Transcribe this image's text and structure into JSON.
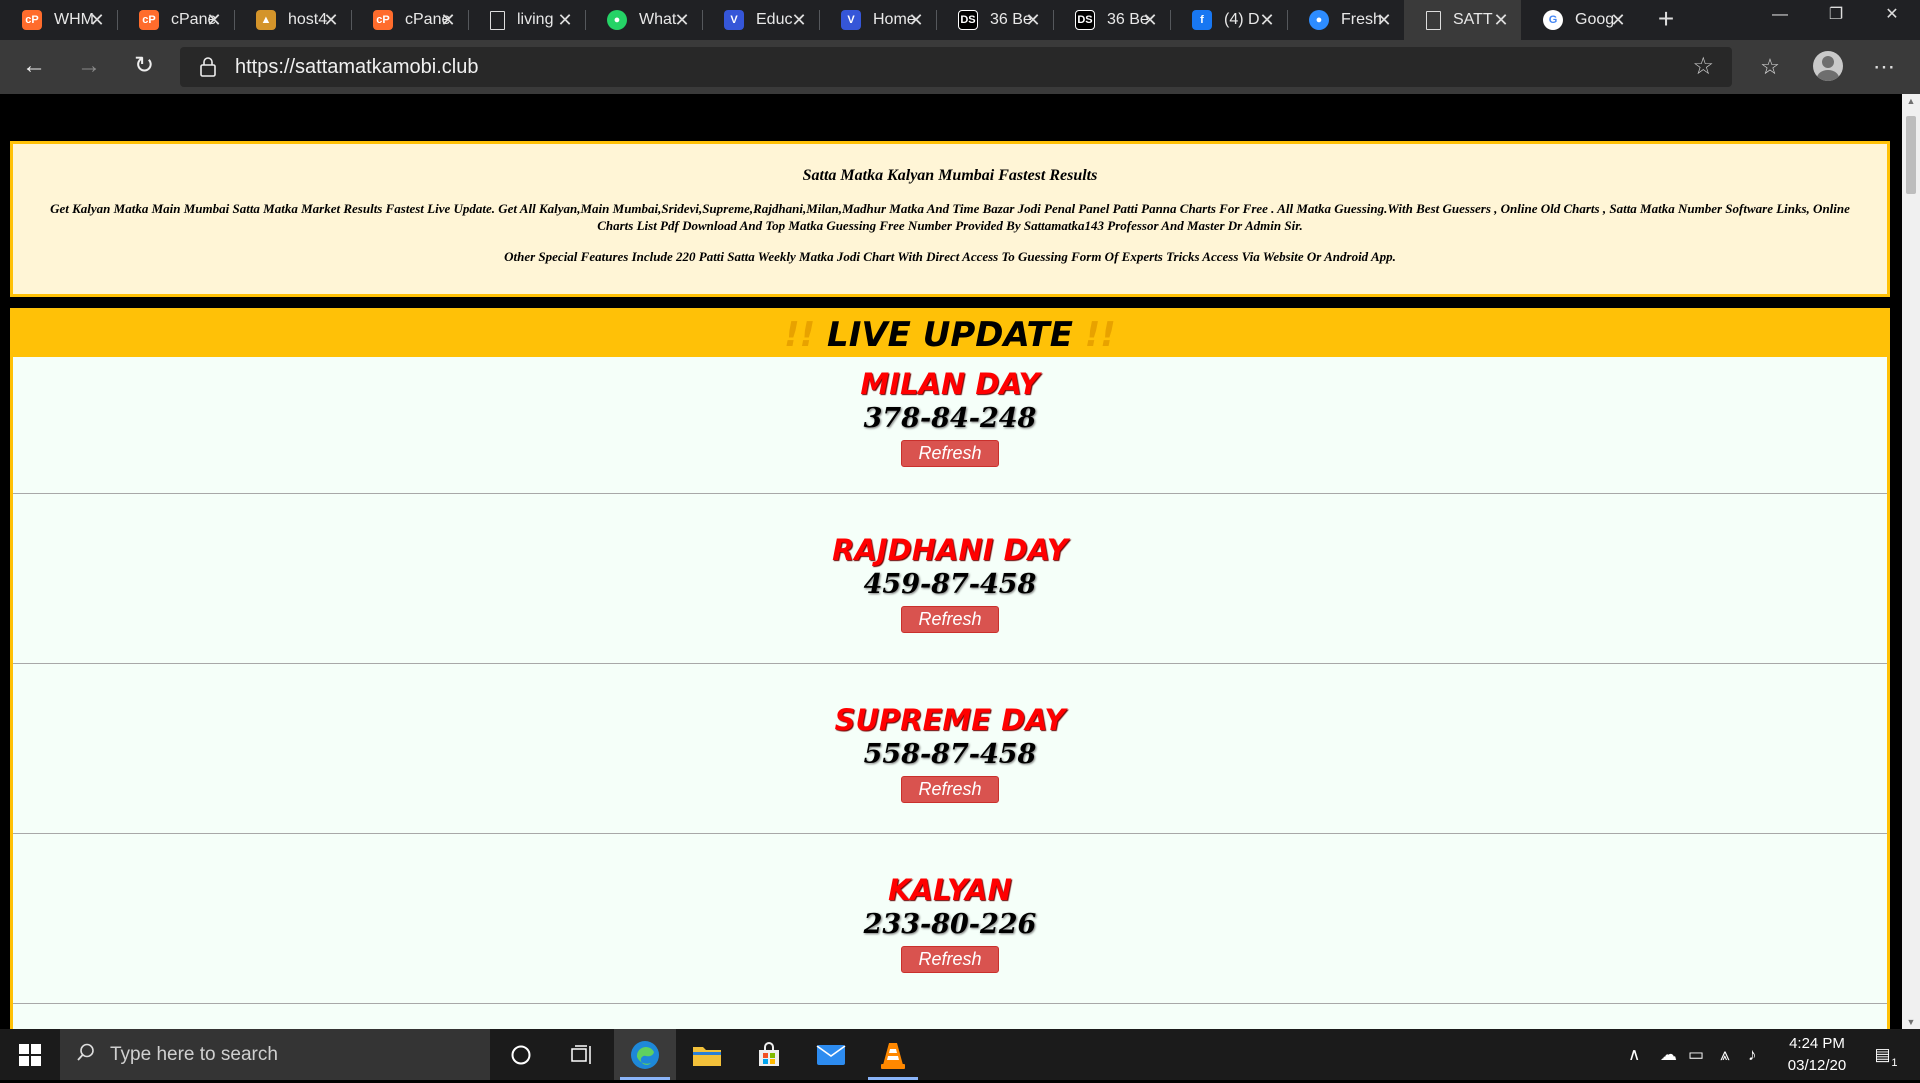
{
  "browser": {
    "tabs": [
      {
        "label": "WHM",
        "favicon": "cpanel-icon",
        "color": "#ff6c2c"
      },
      {
        "label": "cPanel",
        "favicon": "cpanel-icon",
        "color": "#ff6c2c"
      },
      {
        "label": "host4",
        "favicon": "host-icon",
        "color": "#d4942a"
      },
      {
        "label": "cPanel",
        "favicon": "cpanel-icon",
        "color": "#ff6c2c"
      },
      {
        "label": "living",
        "favicon": "page-icon",
        "color": "#dddddd"
      },
      {
        "label": "What",
        "favicon": "whatsapp-icon",
        "color": "#25d366"
      },
      {
        "label": "Educ",
        "favicon": "educ-icon",
        "color": "#3556d8"
      },
      {
        "label": "Home",
        "favicon": "home-icon",
        "color": "#3556d8"
      },
      {
        "label": "36 Be",
        "favicon": "ds-icon",
        "color": "#000000"
      },
      {
        "label": "36 Be",
        "favicon": "ds-icon",
        "color": "#000000"
      },
      {
        "label": "(4) D",
        "favicon": "facebook-icon",
        "color": "#1877f2"
      },
      {
        "label": "Fresh",
        "favicon": "fresh-icon",
        "color": "#2d8cff"
      },
      {
        "label": "SATT",
        "favicon": "page-icon",
        "color": "#dddddd"
      },
      {
        "label": "Goog",
        "favicon": "google-icon",
        "color": "#ffffff"
      }
    ],
    "active_tab_index": 12,
    "url": "https://sattamatkamobi.club"
  },
  "page": {
    "intro": {
      "title": "Satta Matka Kalyan Mumbai Fastest Results",
      "description": "Get Kalyan Matka Main Mumbai Satta Matka Market Results Fastest Live Update. Get All Kalyan,Main Mumbai,Sridevi,Supreme,Rajdhani,Milan,Madhur Matka And Time Bazar Jodi Penal Panel Patti Panna Charts For Free . All Matka Guessing.With Best Guessers , Online Old Charts , Satta Matka Number Software Links, Online Charts List Pdf Download And Top Matka Guessing Free Number Provided By Sattamatka143 Professor And Master Dr Admin Sir.",
      "other": "Other Special Features Include 220 Patti Satta Weekly Matka Jodi Chart With Direct Access To Guessing Form Of Experts Tricks Access Via Website Or Android App."
    },
    "live": {
      "heading": "LIVE UPDATE",
      "bang": "!!",
      "results": [
        {
          "market": "MILAN DAY",
          "number": "378-84-248",
          "button": "Refresh"
        },
        {
          "market": "RAJDHANI DAY",
          "number": "459-87-458",
          "button": "Refresh"
        },
        {
          "market": "SUPREME DAY",
          "number": "558-87-458",
          "button": "Refresh"
        },
        {
          "market": "KALYAN",
          "number": "233-80-226",
          "button": "Refresh"
        }
      ]
    }
  },
  "taskbar": {
    "search_placeholder": "Type here to search",
    "time": "4:24 PM",
    "date": "03/12/20",
    "notification_count": "1"
  },
  "colors": {
    "accent": "#ffc107",
    "market_name": "#ff0000",
    "refresh_button": "#d9534f",
    "info_bg": "#fff5d6",
    "result_bg": "#f5fff9"
  }
}
